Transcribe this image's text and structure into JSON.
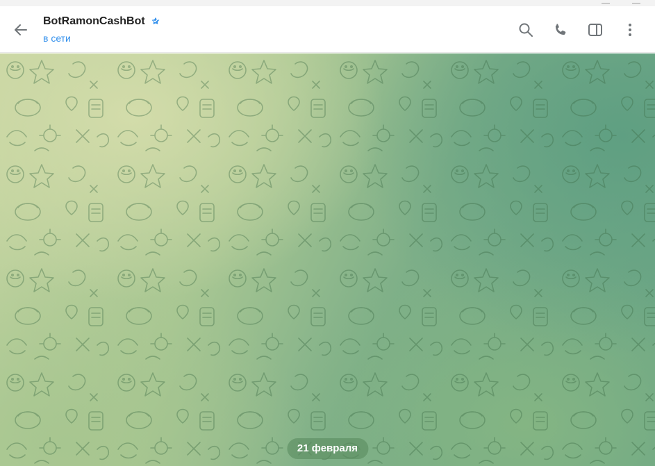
{
  "header": {
    "title": "BotRamonCashBot",
    "status": "в сети",
    "verified_icon": "verified-star-icon",
    "back_icon": "back-arrow-icon",
    "actions": [
      {
        "name": "search",
        "icon": "search-icon"
      },
      {
        "name": "call",
        "icon": "phone-icon"
      },
      {
        "name": "sidebar",
        "icon": "sidebar-toggle-icon"
      },
      {
        "name": "more",
        "icon": "more-vertical-icon"
      }
    ]
  },
  "chat": {
    "date_label": "21 февраля"
  },
  "colors": {
    "accent": "#3390ec",
    "title": "#222222",
    "icon": "#707579",
    "verified": "#3390ec"
  }
}
